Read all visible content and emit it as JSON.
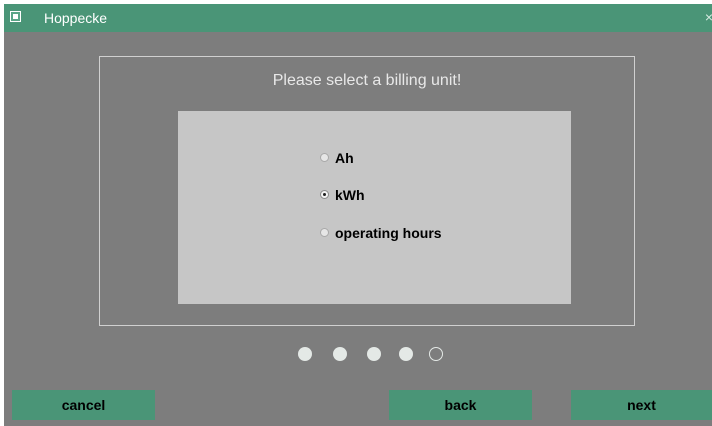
{
  "window": {
    "title": "Hoppecke",
    "close_glyph": "×",
    "app_icon": "app-icon"
  },
  "prompt": "Please select a billing unit!",
  "options": [
    {
      "label": "Ah",
      "selected": false
    },
    {
      "label": "kWh",
      "selected": true
    },
    {
      "label": "operating hours",
      "selected": false
    }
  ],
  "pager": {
    "total_steps": 5,
    "completed_steps": 4
  },
  "buttons": {
    "cancel": "cancel",
    "back": "back",
    "next": "next"
  },
  "colors": {
    "accent": "#4a9577",
    "background": "#7d7d7d",
    "panel": "#c6c6c6"
  }
}
